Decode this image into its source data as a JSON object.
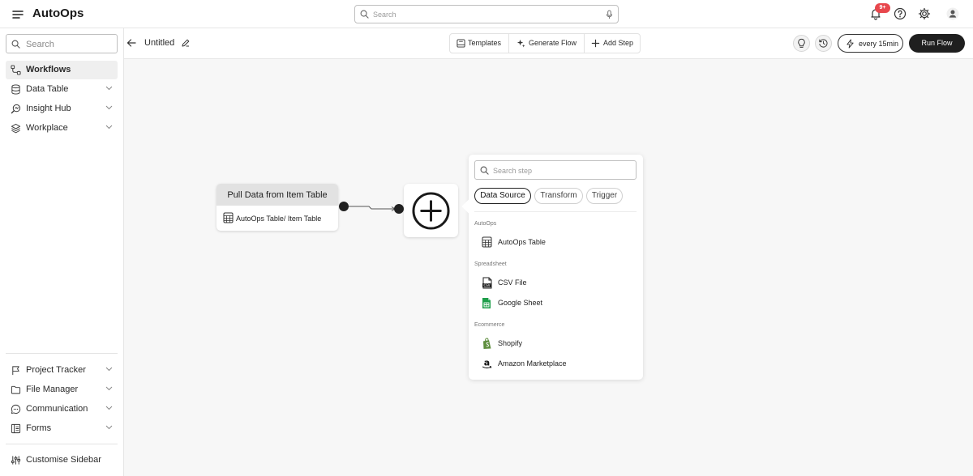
{
  "app": {
    "title": "AutoOps"
  },
  "topbar": {
    "search_placeholder": "Search",
    "notification_count": "9+",
    "icons": [
      "menu-icon",
      "search-icon",
      "microphone-icon",
      "bell-icon",
      "help-icon",
      "gear-icon",
      "user-icon"
    ]
  },
  "sidebar": {
    "search_placeholder": "Search",
    "items": [
      {
        "label": "Workflows",
        "icon": "workflows-icon",
        "active": true
      },
      {
        "label": "Data Table",
        "icon": "database-icon"
      },
      {
        "label": "Insight Hub",
        "icon": "insight-icon"
      },
      {
        "label": "Workplace",
        "icon": "layers-icon"
      }
    ],
    "bottom_items": [
      {
        "label": "Project Tracker",
        "icon": "flag-icon"
      },
      {
        "label": "File Manager",
        "icon": "folder-icon"
      },
      {
        "label": "Communication",
        "icon": "chat-icon"
      },
      {
        "label": "Forms",
        "icon": "form-icon"
      }
    ],
    "customise_label": "Customise Sidebar"
  },
  "subbar": {
    "flow_title": "Untitled",
    "tools": [
      {
        "label": "Templates",
        "icon": "templates-icon"
      },
      {
        "label": "Generate Flow",
        "icon": "sparkle-icon"
      },
      {
        "label": "Add Step",
        "icon": "plus-icon"
      }
    ],
    "schedule_label": "every 15min",
    "run_label": "Run Flow"
  },
  "canvas": {
    "node": {
      "title": "Pull Data from Item Table",
      "source": "AutoOps Table/ Item Table"
    }
  },
  "popover": {
    "search_placeholder": "Search step",
    "tabs": [
      "Data Source",
      "Transform",
      "Trigger"
    ],
    "active_tab": "Data Source",
    "sections": [
      {
        "title": "AutoOps",
        "items": [
          {
            "label": "AutoOps Table",
            "icon": "table-icon"
          }
        ]
      },
      {
        "title": "Spreadsheet",
        "items": [
          {
            "label": "CSV File",
            "icon": "csv-icon"
          },
          {
            "label": "Google Sheet",
            "icon": "google-sheet-icon"
          }
        ]
      },
      {
        "title": "Ecommerce",
        "items": [
          {
            "label": "Shopify",
            "icon": "shopify-icon"
          },
          {
            "label": "Amazon Marketplace",
            "icon": "amazon-icon"
          }
        ]
      }
    ]
  },
  "colors": {
    "accent": "#1f1f1f",
    "badge": "#e8474d",
    "canvas": "#f7f7f7",
    "sheet_green": "#1e9e4a",
    "shopify_green": "#5e8e3e"
  }
}
